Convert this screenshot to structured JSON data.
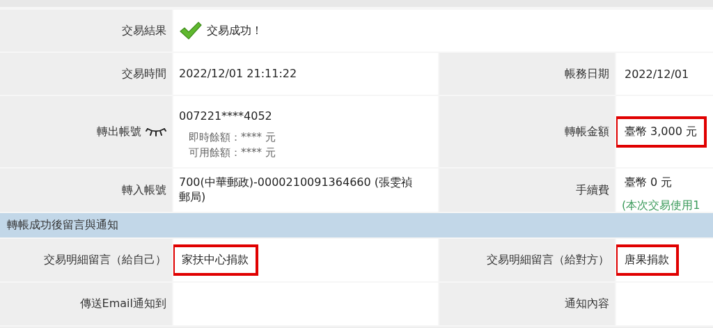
{
  "result": {
    "label": "交易結果",
    "value": "交易成功！"
  },
  "rows": [
    {
      "label": "交易時間",
      "value": "2022/12/01 21:11:22",
      "right_label": "帳務日期",
      "right_value": "2022/12/01",
      "right_highlighted": false
    },
    {
      "label": "轉出帳號",
      "masked": true,
      "value": "007221****4052",
      "balances": [
        "即時餘額：**** 元",
        "可用餘額：**** 元"
      ],
      "right_label": "轉帳金額",
      "right_value": "臺幣 3,000 元",
      "right_highlighted": true
    },
    {
      "label": "轉入帳號",
      "value": "700(中華郵政)-0000210091364660 (張雯禎郵局)",
      "right_label": "手續費",
      "right_value": "臺幣 0 元",
      "right_note": "(本次交易使用1",
      "right_highlighted": false
    }
  ],
  "section": {
    "title": "轉帳成功後留言與通知"
  },
  "notice_rows": [
    {
      "label": "交易明細留言（給自己）",
      "value": "家扶中心捐款",
      "highlighted": true,
      "right_label": "交易明細留言（給對方）",
      "right_value": "唐果捐款",
      "right_highlighted": true
    },
    {
      "label": "傳送Email通知到",
      "right_label": "通知內容"
    }
  ]
}
